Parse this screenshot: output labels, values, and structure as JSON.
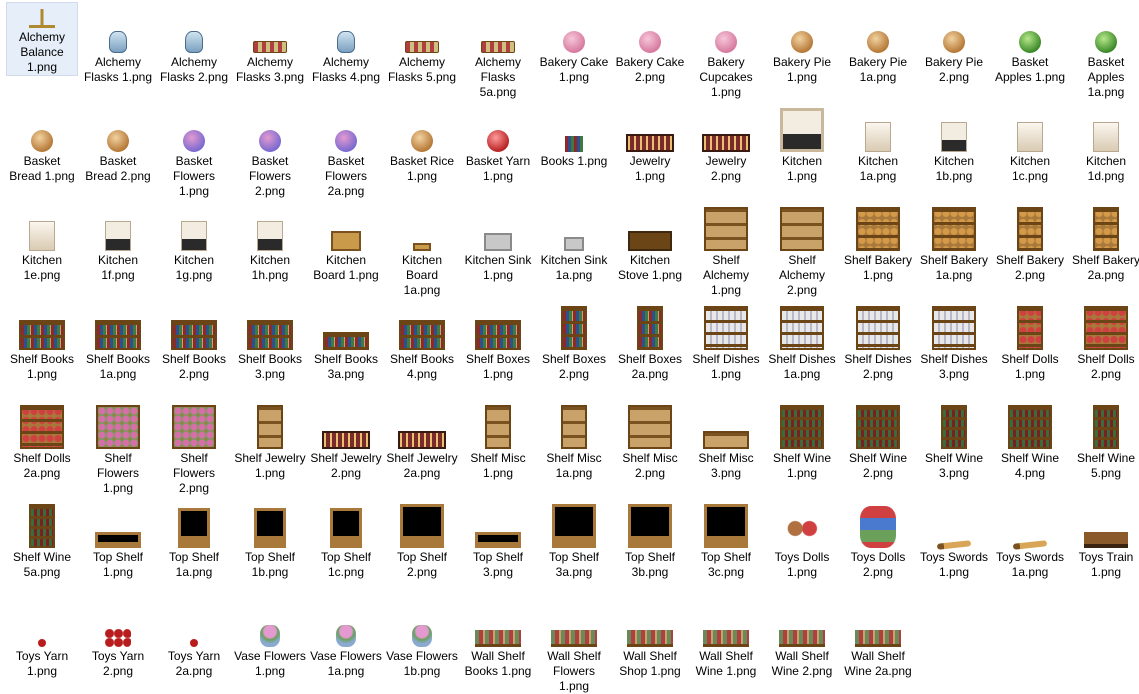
{
  "files": [
    {
      "label": "Alchemy Balance 1.png",
      "icon": "balance-icon",
      "selected": true
    },
    {
      "label": "Alchemy Flasks 1.png",
      "icon": "flask-icon"
    },
    {
      "label": "Alchemy Flasks 2.png",
      "icon": "flask-icon"
    },
    {
      "label": "Alchemy Flasks 3.png",
      "icon": "flask-tray-icon"
    },
    {
      "label": "Alchemy Flasks 4.png",
      "icon": "flask-icon"
    },
    {
      "label": "Alchemy Flasks 5.png",
      "icon": "flask-tray-icon"
    },
    {
      "label": "Alchemy Flasks 5a.png",
      "icon": "flask-tray-icon"
    },
    {
      "label": "Bakery Cake 1.png",
      "icon": "cake-icon"
    },
    {
      "label": "Bakery Cake 2.png",
      "icon": "cake-icon"
    },
    {
      "label": "Bakery Cupcakes 1.png",
      "icon": "cupcakes-icon"
    },
    {
      "label": "Bakery Pie 1.png",
      "icon": "pie-icon"
    },
    {
      "label": "Bakery Pie 1a.png",
      "icon": "pie-icon"
    },
    {
      "label": "Bakery Pie 2.png",
      "icon": "pie-icon"
    },
    {
      "label": "Basket Apples 1.png",
      "icon": "apple-basket-icon"
    },
    {
      "label": "Basket Apples 1a.png",
      "icon": "apple-basket-icon"
    },
    {
      "label": "Basket Bread 1.png",
      "icon": "bread-basket-icon"
    },
    {
      "label": "Basket Bread 2.png",
      "icon": "bread-basket-icon"
    },
    {
      "label": "Basket Flowers 1.png",
      "icon": "flower-basket-icon"
    },
    {
      "label": "Basket Flowers 2.png",
      "icon": "flower-basket-icon"
    },
    {
      "label": "Basket Flowers 2a.png",
      "icon": "flower-basket-icon"
    },
    {
      "label": "Basket Rice 1.png",
      "icon": "rice-basket-icon"
    },
    {
      "label": "Basket Yarn 1.png",
      "icon": "yarn-basket-icon"
    },
    {
      "label": "Books 1.png",
      "icon": "books-icon"
    },
    {
      "label": "Jewelry 1.png",
      "icon": "jewelry-icon"
    },
    {
      "label": "Jewelry 2.png",
      "icon": "jewelry-icon"
    },
    {
      "label": "Kitchen 1.png",
      "icon": "kitchen-tile-icon"
    },
    {
      "label": "Kitchen 1a.png",
      "icon": "kitchen-tile-icon"
    },
    {
      "label": "Kitchen 1b.png",
      "icon": "kitchen-tile-icon"
    },
    {
      "label": "Kitchen 1c.png",
      "icon": "kitchen-tile-icon"
    },
    {
      "label": "Kitchen 1d.png",
      "icon": "kitchen-tile-icon"
    },
    {
      "label": "Kitchen 1e.png",
      "icon": "kitchen-tile-icon"
    },
    {
      "label": "Kitchen 1f.png",
      "icon": "kitchen-tile-icon"
    },
    {
      "label": "Kitchen 1g.png",
      "icon": "kitchen-tile-icon"
    },
    {
      "label": "Kitchen 1h.png",
      "icon": "kitchen-tile-icon"
    },
    {
      "label": "Kitchen Board 1.png",
      "icon": "cutting-board-icon"
    },
    {
      "label": "Kitchen Board 1a.png",
      "icon": "cutting-board-icon"
    },
    {
      "label": "Kitchen Sink 1.png",
      "icon": "sink-icon"
    },
    {
      "label": "Kitchen Sink 1a.png",
      "icon": "sink-icon"
    },
    {
      "label": "Kitchen Stove 1.png",
      "icon": "stove-icon"
    },
    {
      "label": "Shelf Alchemy 1.png",
      "icon": "shelf-icon"
    },
    {
      "label": "Shelf Alchemy 2.png",
      "icon": "shelf-icon"
    },
    {
      "label": "Shelf Bakery 1.png",
      "icon": "bakery-shelf-icon"
    },
    {
      "label": "Shelf Bakery 1a.png",
      "icon": "bakery-shelf-icon"
    },
    {
      "label": "Shelf Bakery 2.png",
      "icon": "bakery-shelf-icon"
    },
    {
      "label": "Shelf Bakery 2a.png",
      "icon": "bakery-shelf-icon"
    },
    {
      "label": "Shelf Books 1.png",
      "icon": "bookshelf-icon"
    },
    {
      "label": "Shelf Books 1a.png",
      "icon": "bookshelf-icon"
    },
    {
      "label": "Shelf Books 2.png",
      "icon": "bookshelf-icon"
    },
    {
      "label": "Shelf Books 3.png",
      "icon": "bookshelf-icon"
    },
    {
      "label": "Shelf Books 3a.png",
      "icon": "bookshelf-icon"
    },
    {
      "label": "Shelf Books 4.png",
      "icon": "bookshelf-icon"
    },
    {
      "label": "Shelf Boxes 1.png",
      "icon": "bookshelf-icon"
    },
    {
      "label": "Shelf Boxes 2.png",
      "icon": "bookshelf-icon"
    },
    {
      "label": "Shelf Boxes 2a.png",
      "icon": "bookshelf-icon"
    },
    {
      "label": "Shelf Dishes 1.png",
      "icon": "dish-shelf-icon"
    },
    {
      "label": "Shelf Dishes 1a.png",
      "icon": "dish-shelf-icon"
    },
    {
      "label": "Shelf Dishes 2.png",
      "icon": "dish-shelf-icon"
    },
    {
      "label": "Shelf Dishes 3.png",
      "icon": "dish-shelf-icon"
    },
    {
      "label": "Shelf Dolls 1.png",
      "icon": "doll-shelf-icon"
    },
    {
      "label": "Shelf Dolls 2.png",
      "icon": "doll-shelf-icon"
    },
    {
      "label": "Shelf Dolls 2a.png",
      "icon": "doll-shelf-icon"
    },
    {
      "label": "Shelf Flowers 1.png",
      "icon": "flower-shelf-icon"
    },
    {
      "label": "Shelf Flowers 2.png",
      "icon": "flower-shelf-icon"
    },
    {
      "label": "Shelf Jewelry 1.png",
      "icon": "shelf-icon"
    },
    {
      "label": "Shelf Jewelry 2.png",
      "icon": "jewelry-icon"
    },
    {
      "label": "Shelf Jewelry 2a.png",
      "icon": "jewelry-icon"
    },
    {
      "label": "Shelf Misc 1.png",
      "icon": "shelf-icon"
    },
    {
      "label": "Shelf Misc 1a.png",
      "icon": "shelf-icon"
    },
    {
      "label": "Shelf Misc 2.png",
      "icon": "shelf-icon"
    },
    {
      "label": "Shelf Misc 3.png",
      "icon": "shelf-icon"
    },
    {
      "label": "Shelf Wine 1.png",
      "icon": "wine-shelf-icon"
    },
    {
      "label": "Shelf Wine 2.png",
      "icon": "wine-shelf-icon"
    },
    {
      "label": "Shelf Wine 3.png",
      "icon": "wine-shelf-icon"
    },
    {
      "label": "Shelf Wine 4.png",
      "icon": "wine-shelf-icon"
    },
    {
      "label": "Shelf Wine 5.png",
      "icon": "wine-shelf-icon"
    },
    {
      "label": "Shelf Wine 5a.png",
      "icon": "wine-shelf-icon"
    },
    {
      "label": "Top Shelf 1.png",
      "icon": "top-shelf-icon"
    },
    {
      "label": "Top Shelf 1a.png",
      "icon": "top-shelf-icon"
    },
    {
      "label": "Top Shelf 1b.png",
      "icon": "top-shelf-icon"
    },
    {
      "label": "Top Shelf 1c.png",
      "icon": "top-shelf-icon"
    },
    {
      "label": "Top Shelf 2.png",
      "icon": "top-shelf-icon"
    },
    {
      "label": "Top Shelf 3.png",
      "icon": "top-shelf-icon"
    },
    {
      "label": "Top Shelf 3a.png",
      "icon": "top-shelf-icon"
    },
    {
      "label": "Top Shelf 3b.png",
      "icon": "top-shelf-icon"
    },
    {
      "label": "Top Shelf 3c.png",
      "icon": "top-shelf-icon"
    },
    {
      "label": "Toys Dolls 1.png",
      "icon": "teddy-bears-icon"
    },
    {
      "label": "Toys Dolls 2.png",
      "icon": "dolls-icon"
    },
    {
      "label": "Toys Swords 1.png",
      "icon": "sword-icon"
    },
    {
      "label": "Toys Swords 1a.png",
      "icon": "sword-icon"
    },
    {
      "label": "Toys Train 1.png",
      "icon": "train-icon"
    },
    {
      "label": "Toys Yarn 1.png",
      "icon": "yarn-ball-icon"
    },
    {
      "label": "Toys Yarn 2.png",
      "icon": "yarn-balls-icon"
    },
    {
      "label": "Toys Yarn 2a.png",
      "icon": "yarn-ball-icon"
    },
    {
      "label": "Vase Flowers 1.png",
      "icon": "vase-icon"
    },
    {
      "label": "Vase Flowers 1a.png",
      "icon": "vase-icon"
    },
    {
      "label": "Vase Flowers 1b.png",
      "icon": "vase-icon"
    },
    {
      "label": "Wall Shelf Books 1.png",
      "icon": "wall-shelf-icon"
    },
    {
      "label": "Wall Shelf Flowers 1.png",
      "icon": "wall-shelf-icon"
    },
    {
      "label": "Wall Shelf Shop 1.png",
      "icon": "wall-shelf-icon"
    },
    {
      "label": "Wall Shelf Wine 1.png",
      "icon": "wall-shelf-icon"
    },
    {
      "label": "Wall Shelf Wine 2.png",
      "icon": "wall-shelf-icon"
    },
    {
      "label": "Wall Shelf Wine 2a.png",
      "icon": "wall-shelf-icon"
    }
  ]
}
